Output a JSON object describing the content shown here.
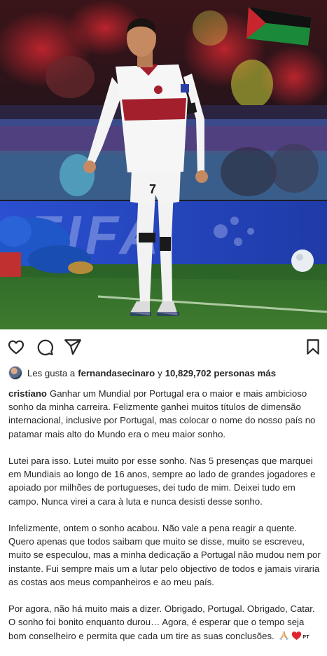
{
  "post": {
    "username": "cristiano",
    "caption_paragraphs": [
      "Ganhar um Mundial por Portugal era o maior e mais ambicioso sonho da minha carreira. Felizmente ganhei muitos títulos de dimensão internacional, inclusive por Portugal, mas colocar o nome do nosso país no patamar mais alto do Mundo era o meu maior sonho.",
      "Lutei para isso. Lutei muito por esse sonho. Nas 5 presenças que marquei em Mundiais ao longo de 16 anos, sempre ao lado de grandes jogadores e apoiado por milhões de portugueses, dei tudo de mim. Deixei tudo em campo. Nunca virei a cara à luta e nunca desisti desse sonho.",
      "Infelizmente, ontem o sonho acabou. Não vale a pena reagir a quente. Quero apenas que todos saibam que muito se disse, muito se escreveu, muito se especulou, mas a minha dedicação a Portugal não mudou nem por instante. Fui sempre mais um a lutar pelo objectivo de todos e jamais viraria as costas aos meus companheiros e ao meu país.",
      "Por agora, não há muito mais a dizer. Obrigado, Portugal. Obrigado, Catar. O sonho foi bonito enquanto durou… Agora, é esperar que o tempo seja bom conselheiro e permita que cada um tire as suas conclusões."
    ],
    "caption_emoji": [
      "pray-icon",
      "heart-icon"
    ],
    "caption_suffix": "PT"
  },
  "likes": {
    "prefix": "Les gusta a",
    "user": "fernandasecinaro",
    "connector": "y",
    "count": "10,829,702 personas más"
  },
  "photo": {
    "board_text": "FIFA",
    "shirt_number": "7"
  },
  "actions": {
    "icons": [
      "heart-icon",
      "comment-icon",
      "share-icon",
      "bookmark-icon"
    ]
  },
  "colors": {
    "text": "#262626",
    "jersey_red": "#a31f2c",
    "pitch_green": "#3f7a2e",
    "board_blue": "#2447c2"
  }
}
